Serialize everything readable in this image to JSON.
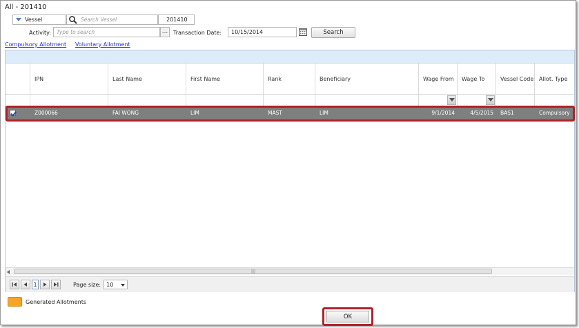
{
  "title": "All - 201410",
  "filters": {
    "vessel_type_label": "Vessel",
    "search_vessel_placeholder": "Search Vessel",
    "period_value": "201410",
    "activity_label": "Activity:",
    "activity_placeholder": "Type to search",
    "ellipsis_label": "...",
    "transaction_date_label": "Transaction Date:",
    "transaction_date_value": "10/15/2014",
    "search_button_label": "Search"
  },
  "tabs": [
    {
      "label": "Compulsory Allotment"
    },
    {
      "label": "Voluntary Allotment"
    }
  ],
  "grid": {
    "columns": [
      {
        "label": ""
      },
      {
        "label": "IPN"
      },
      {
        "label": "Last Name"
      },
      {
        "label": "First Name"
      },
      {
        "label": "Rank"
      },
      {
        "label": "Beneficiary"
      },
      {
        "label": "Wage From"
      },
      {
        "label": "Wage To"
      },
      {
        "label": "Vessel Code"
      },
      {
        "label": "Allot. Type"
      }
    ],
    "rows": [
      {
        "selected": true,
        "ipn": "Z000066",
        "last_name": "FAI WONG",
        "first_name": "LIM",
        "rank": "MAST",
        "beneficiary": "LIM",
        "wage_from": "9/1/2014",
        "wage_to": "4/5/2015",
        "vessel_code": "BAS1",
        "allot_type": "Compulsory"
      }
    ],
    "scroll_grip": "|||"
  },
  "pager": {
    "current_page": "1",
    "page_size_label": "Page size:",
    "page_size_value": "10"
  },
  "legend": {
    "label": "Generated Allotments",
    "color": "#f5a623"
  },
  "footer": {
    "ok_label": "OK"
  },
  "colors": {
    "highlight_border": "#b0212b",
    "selected_row": "#7f7f7f",
    "grid_band": "#ddecfb",
    "link": "#1f2fd0"
  }
}
